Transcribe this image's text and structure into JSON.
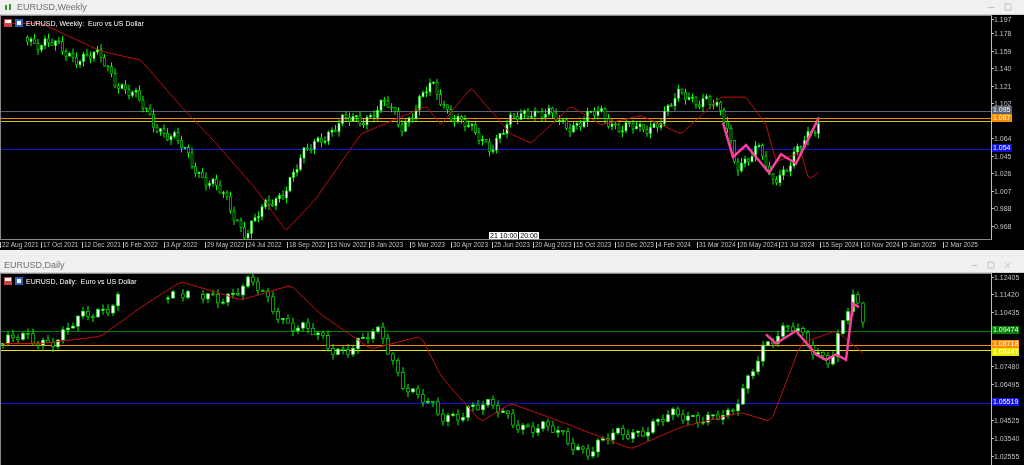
{
  "windows": [
    {
      "title": "EURUSD,Weekly",
      "chart_label": "EURUSD, Weekly:  Euro vs US Dollar",
      "show_close": false,
      "price_ticks": [
        "1.197",
        "1.178",
        "1.159",
        "1.140",
        "1.121",
        "1.102",
        "1.064",
        "1.045",
        "1.026",
        "1.007",
        "0.988",
        "0.968"
      ],
      "time_ticks": [
        "22 Aug 2021",
        "17 Oct 2021",
        "12 Dec 2021",
        "6 Feb 2022",
        "3 Apr 2022",
        "29 May 2022",
        "24 Jul 2022",
        "18 Sep 2022",
        "13 Nov 2022",
        "8 Jan 2023",
        "5 Mar 2023",
        "30 Apr 2023",
        "25 Jun 2023",
        "20 Aug 2023",
        "15 Oct 2023",
        "10 Dec 2023",
        "4 Feb 2024",
        "31 Mar 2024",
        "26 May 2024",
        "21 Jul 2024",
        "15 Sep 2024",
        "10 Nov 2024",
        "5 Jan 2025",
        "2 Mar 2025"
      ],
      "time_markers": [
        "21 10:00",
        "20:00"
      ],
      "levels": [
        {
          "color": "#5a6470",
          "tag": "1.095"
        },
        {
          "color": "#ff8c00",
          "tag": "1.087"
        },
        {
          "color": "#d4c800"
        },
        {
          "color": "#1010e0",
          "tag": "1.054"
        }
      ]
    },
    {
      "title": "EURUSD,Daily",
      "chart_label": "EURUSD, Daily:  Euro vs US Dollar",
      "show_close": true,
      "price_ticks": [
        "1.12405",
        "1.11420",
        "1.10435",
        "1.07480",
        "1.06495",
        "1.04525",
        "1.03540",
        "1.02555"
      ],
      "levels": [
        {
          "color": "#008000",
          "tag": "1.09474"
        },
        {
          "color": "#ff8c00",
          "tag": "1.08718"
        },
        {
          "color": "#e8e800",
          "tag": "1.08447"
        },
        {
          "color": "#1010e0",
          "tag": "1.05519"
        }
      ]
    }
  ]
}
